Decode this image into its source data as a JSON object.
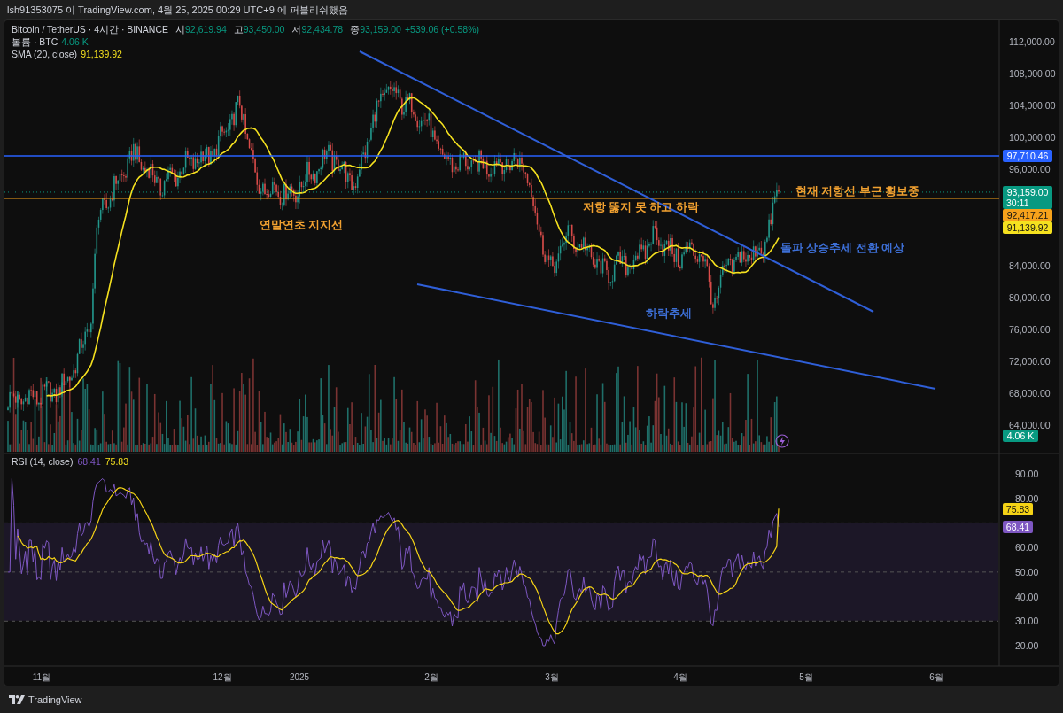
{
  "header": {
    "caption": "lsh91353075 이 TradingView.com, 4월 25, 2025 00:29 UTC+9 에 퍼블리쉬했음"
  },
  "legend": {
    "symbol": "Bitcoin / TetherUS · 4시간 · BINANCE",
    "ohlc": [
      {
        "label": "시",
        "value": "92,619.94"
      },
      {
        "label": "고",
        "value": "93,450.00"
      },
      {
        "label": "저",
        "value": "92,434.78"
      },
      {
        "label": "종",
        "value": "93,159.00"
      }
    ],
    "change": "+539.06 (+0.58%)",
    "volume": {
      "label": "볼륨 · BTC",
      "value": "4.06 K"
    },
    "sma": {
      "label": "SMA (20, close)",
      "value": "91,139.92"
    }
  },
  "price_axis": {
    "ticks": [
      "112,000.00",
      "108,000.00",
      "104,000.00",
      "100,000.00",
      "96,000.00",
      "84,000.00",
      "80,000.00",
      "76,000.00",
      "72,000.00",
      "68,000.00",
      "64,000.00"
    ]
  },
  "price_tags": [
    {
      "text": "97,710.46",
      "color": "#2962ff"
    },
    {
      "text": "93,159.00",
      "sub": "30:11",
      "color": "#089981"
    },
    {
      "text": "92,417.21",
      "color": "#f7a21b"
    },
    {
      "text": "91,139.92",
      "color": "#f5e11f"
    },
    {
      "text": "4.06 K",
      "color": "#089981"
    }
  ],
  "annotations": [
    {
      "text": "연말연초 지지선",
      "color": "#f0a030"
    },
    {
      "text": "저항 뚫지 못 하고 하락",
      "color": "#f0a030"
    },
    {
      "text": "현재 저항선 부근 횡보중",
      "color": "#f0a030"
    },
    {
      "text": "돌파 상승추세 전환 예상",
      "color": "#3d6fd6"
    },
    {
      "text": "하락추세",
      "color": "#3d6fd6"
    }
  ],
  "rsi": {
    "label": "RSI (14, close)",
    "value": "68.41",
    "ma_value": "75.83",
    "ticks": [
      "90.00",
      "80.00",
      "60.00",
      "50.00",
      "40.00",
      "30.00",
      "20.00"
    ],
    "tags": [
      {
        "text": "75.83",
        "color": "#f5d316"
      },
      {
        "text": "68.41",
        "color": "#7e57c2"
      }
    ]
  },
  "time_axis": {
    "labels": [
      "11월",
      "12월",
      "2025",
      "2월",
      "3월",
      "4월",
      "5월",
      "6월"
    ]
  },
  "footer": {
    "brand": "TradingView"
  }
}
